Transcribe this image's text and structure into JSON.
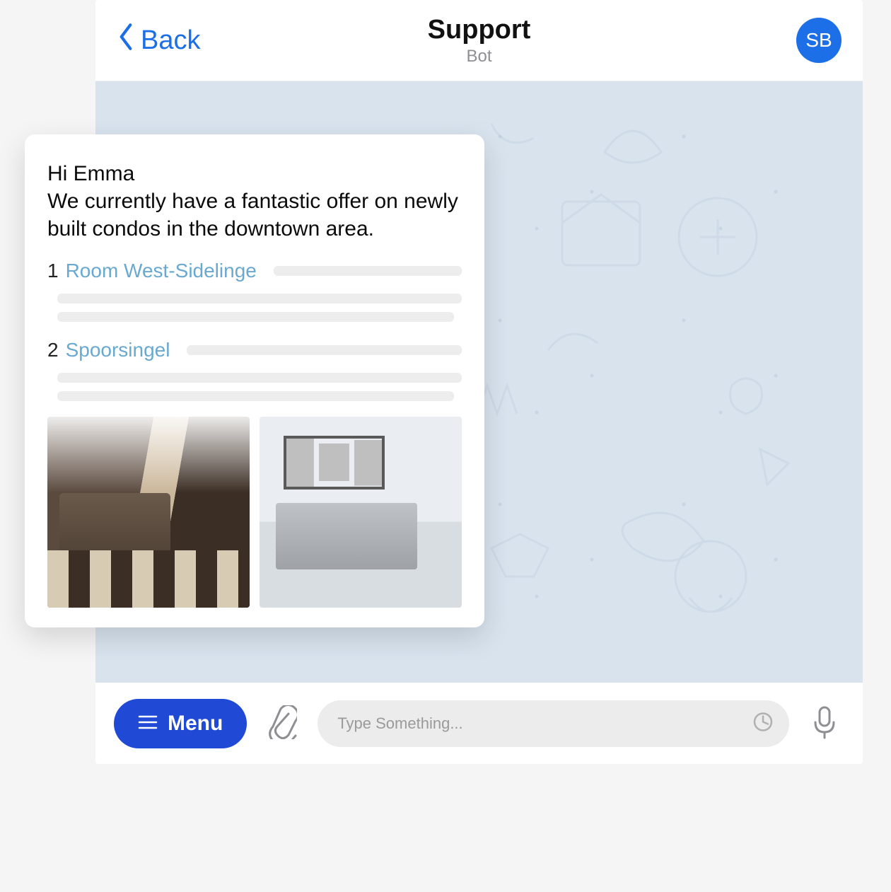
{
  "header": {
    "back_label": "Back",
    "title": "Support",
    "subtitle": "Bot",
    "avatar_initials": "SB"
  },
  "message": {
    "greeting": "Hi Emma",
    "body": "We currently have a fantastic offer on newly built condos in the downtown area.",
    "listings": [
      {
        "num": "1",
        "title": "Room West-Sidelinge"
      },
      {
        "num": "2",
        "title": "Spoorsingel"
      }
    ]
  },
  "input": {
    "menu_label": "Menu",
    "placeholder": "Type Something..."
  }
}
